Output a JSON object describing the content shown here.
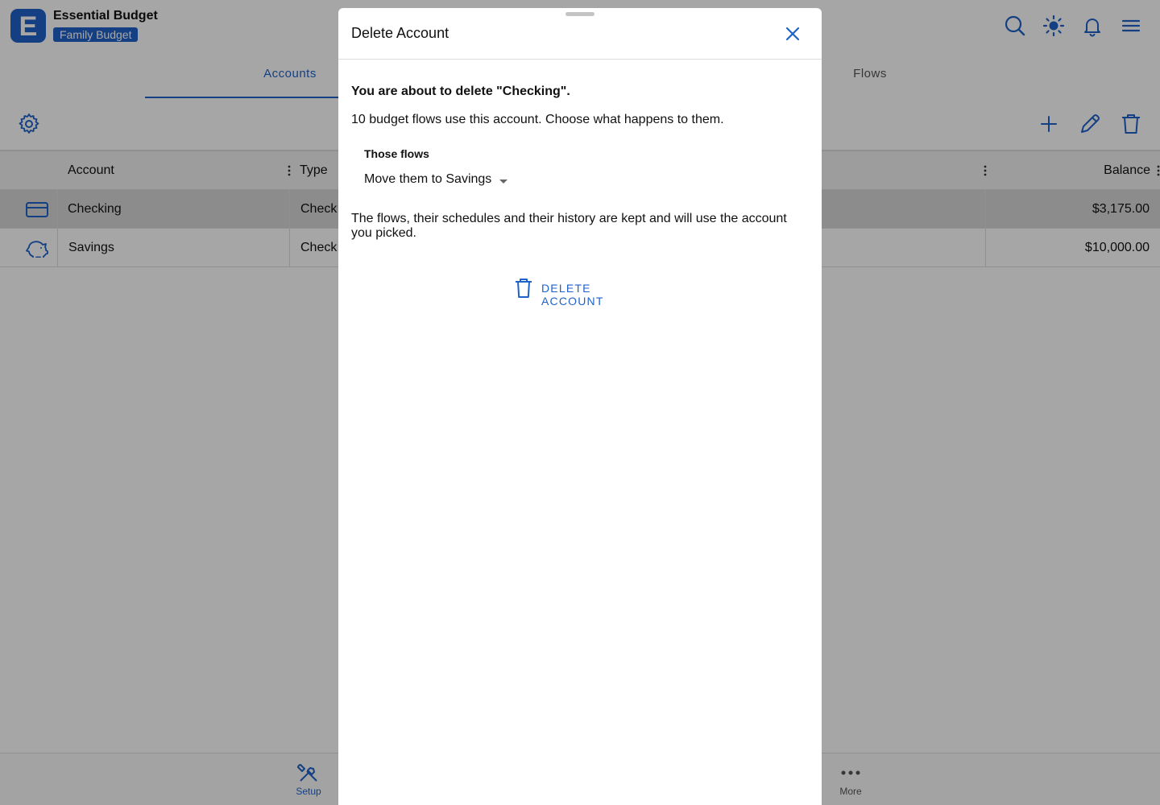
{
  "app": {
    "title": "Essential Budget",
    "budget_name": "Family Budget"
  },
  "header_icons": [
    "search-icon",
    "brightness-icon",
    "bell-icon",
    "menu-icon"
  ],
  "tabs": [
    {
      "label": "Accounts",
      "selected": true
    },
    {
      "label": "Flows",
      "selected": false
    }
  ],
  "table": {
    "columns": [
      "Account",
      "Type",
      "Balance"
    ],
    "rows": [
      {
        "icon": "credit-card-icon",
        "account": "Checking",
        "type": "Check",
        "balance": "$3,175.00",
        "selected": true
      },
      {
        "icon": "piggy-bank-icon",
        "account": "Savings",
        "type": "Check",
        "balance": "$10,000.00",
        "selected": false
      }
    ]
  },
  "bottom_nav": [
    {
      "label": "Setup",
      "icon": "tools-icon",
      "active": true
    },
    {
      "label": "More",
      "icon": "more-dots-icon",
      "active": false
    }
  ],
  "modal": {
    "title": "Delete Account",
    "headline": "You are about to delete \"Checking\".",
    "subtext": "10 budget flows use this account. Choose what happens to them.",
    "field_label": "Those flows",
    "select_value": "Move them to Savings",
    "note": "The flows, their schedules and their history are kept and will use the account you picked.",
    "delete_label": "DELETE ACCOUNT"
  },
  "colors": {
    "accent": "#1f62c9",
    "scrim": "rgba(0,0,0,0.35)",
    "selected_row": "#d8d8d8"
  }
}
